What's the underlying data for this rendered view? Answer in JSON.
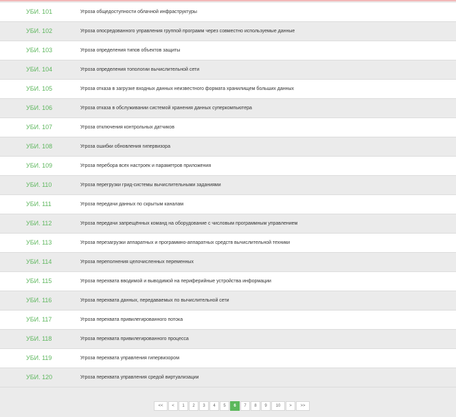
{
  "threats": [
    {
      "code": "УБИ. 101",
      "title": "Угроза общедоступности облачной инфраструктуры"
    },
    {
      "code": "УБИ. 102",
      "title": "Угроза опосредованного управления группой программ через совместно используемые данные"
    },
    {
      "code": "УБИ. 103",
      "title": "Угроза определения типов объектов защиты"
    },
    {
      "code": "УБИ. 104",
      "title": "Угроза определения топологии вычислительной сети"
    },
    {
      "code": "УБИ. 105",
      "title": "Угроза отказа в загрузке входных данных неизвестного формата хранилищем больших данных"
    },
    {
      "code": "УБИ. 106",
      "title": "Угроза отказа в обслуживании системой хранения данных суперкомпьютера"
    },
    {
      "code": "УБИ. 107",
      "title": "Угроза отключения контрольных датчиков"
    },
    {
      "code": "УБИ. 108",
      "title": "Угроза ошибки обновления гипервизора"
    },
    {
      "code": "УБИ. 109",
      "title": "Угроза перебора всех настроек и параметров приложения"
    },
    {
      "code": "УБИ. 110",
      "title": "Угроза перегрузки грид-системы вычислительными заданиями"
    },
    {
      "code": "УБИ. 111",
      "title": "Угроза передачи данных по скрытым каналам"
    },
    {
      "code": "УБИ. 112",
      "title": "Угроза передачи запрещённых команд на оборудование с числовым программным управлением"
    },
    {
      "code": "УБИ. 113",
      "title": "Угроза перезагрузки аппаратных и программно-аппаратных средств вычислительной техники"
    },
    {
      "code": "УБИ. 114",
      "title": "Угроза переполнения целочисленных переменных"
    },
    {
      "code": "УБИ. 115",
      "title": "Угроза перехвата вводимой и выводимой на периферийные устройства информации"
    },
    {
      "code": "УБИ. 116",
      "title": "Угроза перехвата данных, передаваемых по вычислительной сети"
    },
    {
      "code": "УБИ. 117",
      "title": "Угроза перехвата привилегированного потока"
    },
    {
      "code": "УБИ. 118",
      "title": "Угроза перехвата привилегированного процесса"
    },
    {
      "code": "УБИ. 119",
      "title": "Угроза перехвата управления гипервизором"
    },
    {
      "code": "УБИ. 120",
      "title": "Угроза перехвата управления средой виртуализации"
    }
  ],
  "pagination": {
    "first": "<<",
    "prev": "<",
    "pages": [
      "1",
      "2",
      "3",
      "4",
      "5",
      "6",
      "7",
      "8",
      "9",
      "10"
    ],
    "active": "6",
    "next": ">",
    "last": ">>"
  },
  "colors": {
    "accent": "#5cb85c",
    "code_text": "#5eb75e",
    "top_accent": "#f2b8b8"
  }
}
